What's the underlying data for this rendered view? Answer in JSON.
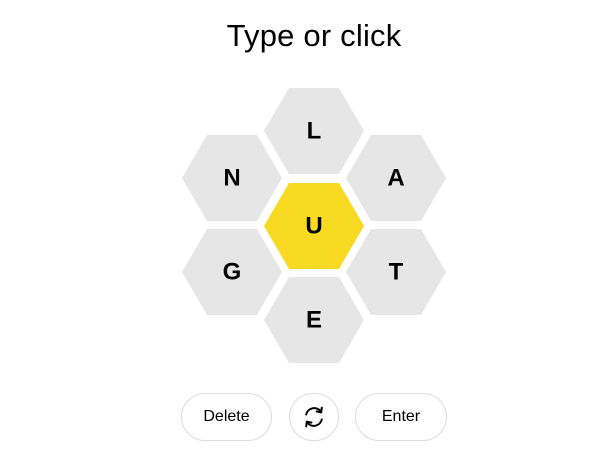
{
  "prompt": "Type or click",
  "hive": {
    "center_letter": "U",
    "outer_letters": {
      "top": "L",
      "upper_left": "N",
      "upper_right": "A",
      "lower_left": "G",
      "lower_right": "T",
      "bottom": "E"
    },
    "center_color": "#f7da21",
    "outer_color": "#e6e6e6"
  },
  "controls": {
    "delete_label": "Delete",
    "shuffle_icon": "shuffle-arrows-icon",
    "enter_label": "Enter"
  }
}
